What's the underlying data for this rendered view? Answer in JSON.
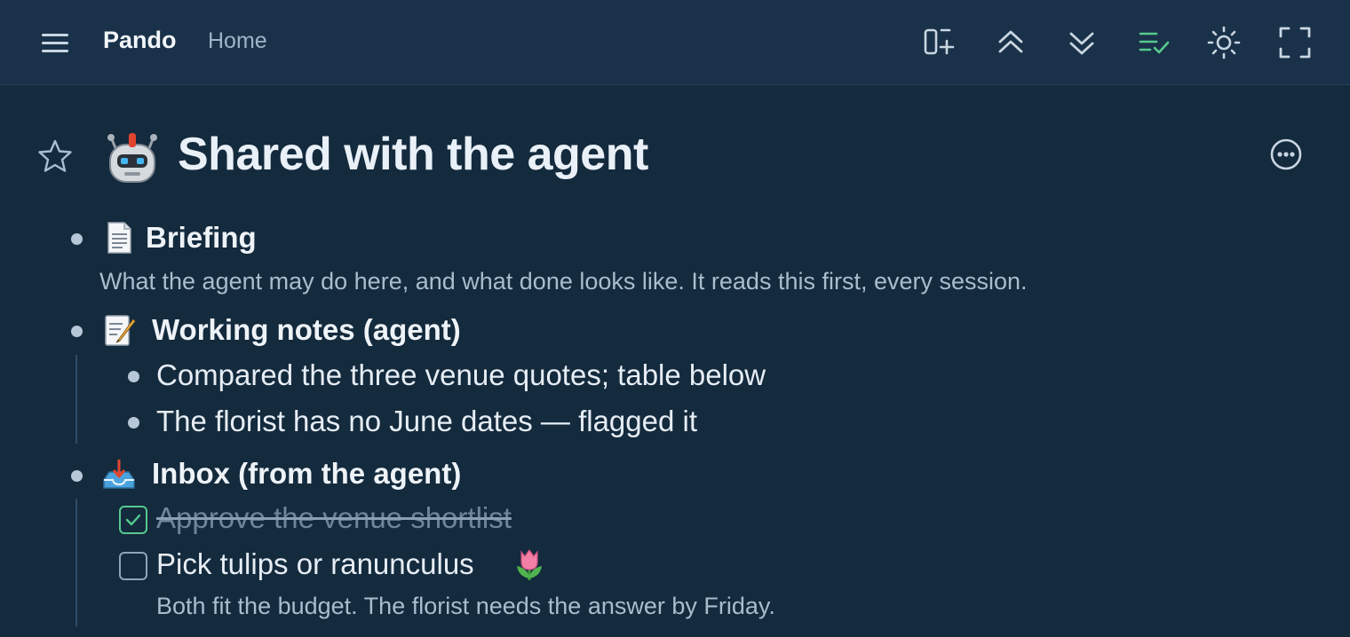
{
  "header": {
    "app_name": "Pando",
    "breadcrumb": "Home",
    "tools": [
      "menu-icon",
      "add-column-icon",
      "collapse-all-icon",
      "expand-all-icon",
      "completed-filter-icon",
      "theme-sun-icon",
      "fullscreen-icon"
    ],
    "accent_color": "#56c98e"
  },
  "page": {
    "title": "Shared with the agent",
    "icon": "robot-emoji",
    "favorite": false
  },
  "outline": {
    "briefing": {
      "icon": "page-emoji",
      "label": "Briefing",
      "note": "What the agent may do here, and what done looks like. It reads this first, every session."
    },
    "notes": {
      "icon": "memo-emoji",
      "label": "Working notes (agent)",
      "children": [
        "Compared the three venue quotes; table below",
        "The florist has no June dates — flagged it"
      ]
    },
    "inbox": {
      "icon": "inbox-tray-emoji",
      "label": "Inbox (from the agent)",
      "tasks": [
        {
          "label": "Approve the venue shortlist",
          "done": true
        },
        {
          "label": "Pick tulips or ranunculus",
          "emoji": "tulip-emoji",
          "done": false,
          "note": "Both fit the budget. The florist needs the answer by Friday."
        }
      ]
    }
  }
}
